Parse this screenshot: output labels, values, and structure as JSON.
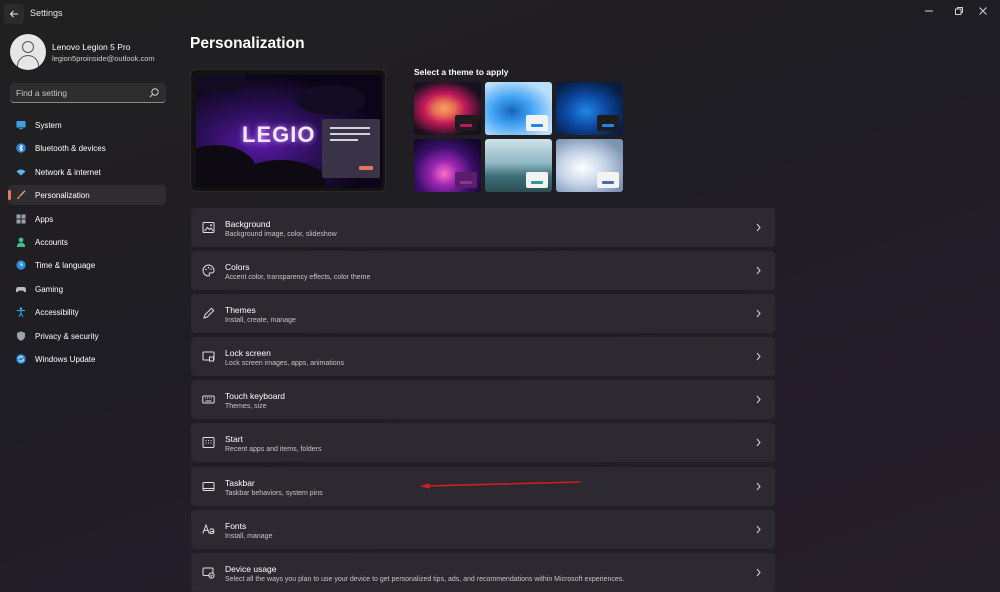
{
  "window": {
    "title": "Settings",
    "back_icon": "arrow-left-icon",
    "controls": [
      "minimize-icon",
      "restore-icon",
      "close-icon"
    ]
  },
  "profile": {
    "name": "Lenovo Legion 5 Pro",
    "email": "legion5proinside@outlook.com"
  },
  "search": {
    "placeholder": "Find a setting",
    "value": ""
  },
  "sidebar": {
    "items": [
      {
        "label": "System",
        "icon": "monitor-icon",
        "active": false
      },
      {
        "label": "Bluetooth & devices",
        "icon": "bluetooth-icon",
        "active": false
      },
      {
        "label": "Network & internet",
        "icon": "wifi-icon",
        "active": false
      },
      {
        "label": "Personalization",
        "icon": "brush-icon",
        "active": true
      },
      {
        "label": "Apps",
        "icon": "apps-icon",
        "active": false
      },
      {
        "label": "Accounts",
        "icon": "person-icon",
        "active": false
      },
      {
        "label": "Time & language",
        "icon": "globe-clock-icon",
        "active": false
      },
      {
        "label": "Gaming",
        "icon": "gamepad-icon",
        "active": false
      },
      {
        "label": "Accessibility",
        "icon": "accessibility-icon",
        "active": false
      },
      {
        "label": "Privacy & security",
        "icon": "shield-icon",
        "active": false
      },
      {
        "label": "Windows Update",
        "icon": "update-icon",
        "active": false
      }
    ]
  },
  "main": {
    "title": "Personalization",
    "preview_logo": "LEGIO",
    "themes_label": "Select a theme to apply",
    "themes": [
      {
        "name": "flower-theme",
        "selected": false
      },
      {
        "name": "windows-light-theme",
        "selected": false
      },
      {
        "name": "windows-dark-theme",
        "selected": false
      },
      {
        "name": "glow-theme",
        "selected": false
      },
      {
        "name": "captured-motion-theme",
        "selected": false
      },
      {
        "name": "sunrise-theme",
        "selected": false
      }
    ],
    "settings": [
      {
        "title": "Background",
        "desc": "Background image, color, slideshow",
        "icon": "image-icon"
      },
      {
        "title": "Colors",
        "desc": "Accent color, transparency effects, color theme",
        "icon": "palette-icon"
      },
      {
        "title": "Themes",
        "desc": "Install, create, manage",
        "icon": "pen-icon"
      },
      {
        "title": "Lock screen",
        "desc": "Lock screen images, apps, animations",
        "icon": "lock-screen-icon"
      },
      {
        "title": "Touch keyboard",
        "desc": "Themes, size",
        "icon": "keyboard-icon"
      },
      {
        "title": "Start",
        "desc": "Recent apps and items, folders",
        "icon": "start-icon"
      },
      {
        "title": "Taskbar",
        "desc": "Taskbar behaviors, system pins",
        "icon": "taskbar-icon"
      },
      {
        "title": "Fonts",
        "desc": "Install, manage",
        "icon": "fonts-icon"
      },
      {
        "title": "Device usage",
        "desc": "Select all the ways you plan to use your device to get personalized tips, ads, and recommendations within Microsoft experiences.",
        "icon": "device-usage-icon"
      }
    ]
  },
  "colors": {
    "accent": "#e07a5f",
    "background": "#202020",
    "card": "#2c2a30",
    "annotation_arrow": "#d21e1e"
  }
}
